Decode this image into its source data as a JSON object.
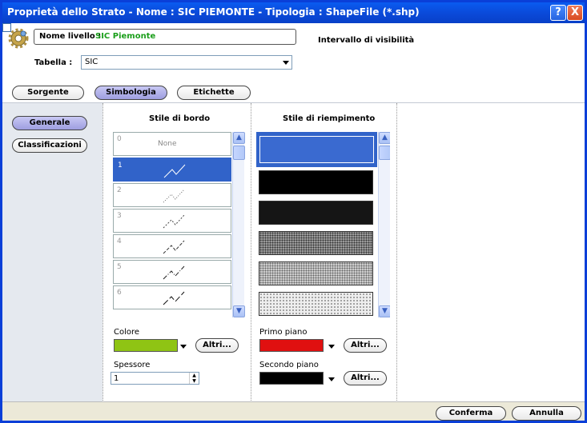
{
  "window": {
    "title": "Proprietà dello Strato - Nome : SIC PIEMONTE - Tipologia : ShapeFile (*.shp)",
    "help": "?",
    "close": "X"
  },
  "header": {
    "icon": "gear-icon",
    "name_label": "Nome livello :",
    "name_value": "SIC Piemonte",
    "visibility_label": "Intervallo di visibilità",
    "visibility_checked": false,
    "table_label": "Tabella :",
    "table_value": "SIC"
  },
  "tabs": [
    {
      "label": "Sorgente",
      "selected": false
    },
    {
      "label": "Simbologia",
      "selected": true
    },
    {
      "label": "Etichette",
      "selected": false
    }
  ],
  "nav": [
    {
      "label": "Generale",
      "selected": true
    },
    {
      "label": "Classificazioni",
      "selected": false
    }
  ],
  "border": {
    "title": "Stile di bordo",
    "items": [
      {
        "num": "0",
        "label": "None"
      },
      {
        "num": "1"
      },
      {
        "num": "2"
      },
      {
        "num": "3"
      },
      {
        "num": "4"
      },
      {
        "num": "5"
      },
      {
        "num": "6"
      }
    ],
    "selected_index": 1,
    "color_label": "Colore",
    "color_value": "#8fc414",
    "more_label": "Altri...",
    "thickness_label": "Spessore",
    "thickness_value": "1"
  },
  "fill": {
    "title": "Stile di riempimento",
    "selected_index": 0,
    "foreground_label": "Primo piano",
    "foreground_value": "#e01010",
    "background_label": "Secondo piano",
    "background_value": "#000000",
    "more_label": "Altri..."
  },
  "footer": {
    "ok_label": "Conferma",
    "cancel_label": "Annulla"
  }
}
